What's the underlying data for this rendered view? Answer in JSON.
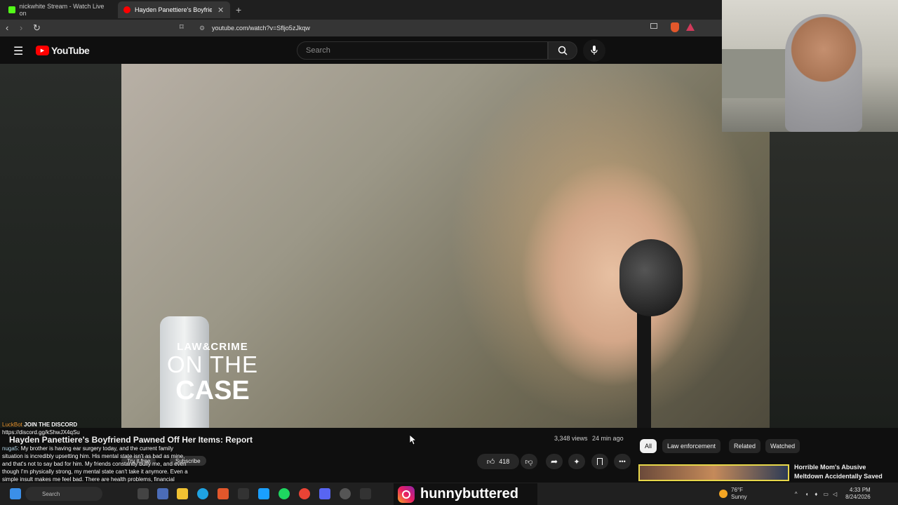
{
  "browser": {
    "tabs": [
      {
        "title": "nickwhite Stream - Watch Live on",
        "active": false
      },
      {
        "title": "Hayden Panettiere's Boyfriend",
        "active": true
      }
    ],
    "url": "youtube.com/watch?v=Sfljo5zJkqw"
  },
  "youtube": {
    "logo_text": "YouTube",
    "search_placeholder": "Search"
  },
  "video": {
    "overlay_logo": {
      "line1": "LAW&CRIME",
      "line2": "ON THE",
      "line3": "CASE"
    },
    "title": "Hayden Panettiere's Boyfriend Pawned Off Her Items: Report",
    "views": "3,348 views",
    "age": "24 min ago",
    "likes": "418",
    "subscribe": "Subscribe",
    "try_free": "Try it free"
  },
  "chips": [
    "All",
    "Law enforcement",
    "Related",
    "Watched"
  ],
  "recommendation": {
    "title": "Horrible Mom's Abusive Meltdown Accidentally Saved"
  },
  "chat": {
    "line1_user": "LuckBot",
    "line1_text": "JOIN THE DISCORD",
    "line2": "https://discord.gg/kShwJX4qSu",
    "line3_user": "nuga5:",
    "line3_text": "My brother is having ear surgery today, and the current family situation is incredibly upsetting him. His mental state isn't as bad as mine, and that's not to say bad for him. My friends constantly bully me, and even though I'm physically strong, my mental state can't take it anymore. Even a simple insult makes me feel bad. There are health problems, financial problems, and more."
  },
  "taskbar": {
    "search": "Search",
    "instagram_handle": "hunnybuttered",
    "weather_temp": "76°F",
    "weather_desc": "Sunny",
    "time": "4:33 PM",
    "date": "8/24/2026"
  }
}
